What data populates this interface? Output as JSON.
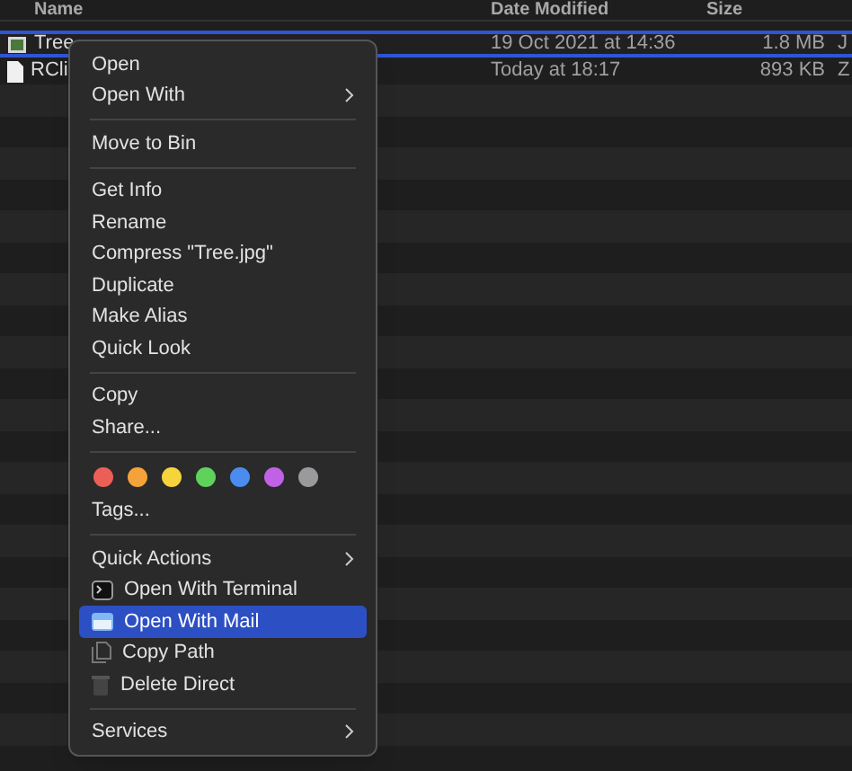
{
  "columns": [
    {
      "label": "Name"
    },
    {
      "label": "Date Modified"
    },
    {
      "label": "Size"
    }
  ],
  "files": [
    {
      "name": "Tree",
      "date": "19 Oct 2021 at 14:36",
      "size": "1.8 MB",
      "column_4": "J",
      "selected": true,
      "kind": "image"
    },
    {
      "name": "RCli",
      "date": "Today at 18:17",
      "size": "893 KB",
      "column_4": "Z",
      "selected": false,
      "kind": "document"
    }
  ],
  "context_menu": {
    "items": [
      {
        "kind": "item",
        "label": "Open",
        "submenu": false
      },
      {
        "kind": "item",
        "label": "Open With",
        "submenu": true
      },
      {
        "kind": "separator"
      },
      {
        "kind": "item",
        "label": "Move to Bin",
        "submenu": false
      },
      {
        "kind": "separator"
      },
      {
        "kind": "item",
        "label": "Get Info",
        "submenu": false
      },
      {
        "kind": "item",
        "label": "Rename",
        "submenu": false
      },
      {
        "kind": "item",
        "label": "Compress \"Tree.jpg\"",
        "submenu": false
      },
      {
        "kind": "item",
        "label": "Duplicate",
        "submenu": false
      },
      {
        "kind": "item",
        "label": "Make Alias",
        "submenu": false
      },
      {
        "kind": "item",
        "label": "Quick Look",
        "submenu": false
      },
      {
        "kind": "separator"
      },
      {
        "kind": "item",
        "label": "Copy",
        "submenu": false
      },
      {
        "kind": "item",
        "label": "Share...",
        "submenu": false
      },
      {
        "kind": "separator"
      },
      {
        "kind": "tags",
        "dots": [
          {
            "color": "#ec5f57"
          },
          {
            "color": "#f5a23a"
          },
          {
            "color": "#f6d43c"
          },
          {
            "color": "#5fd25c"
          },
          {
            "color": "#4b8cf0"
          },
          {
            "color": "#c061e6"
          },
          {
            "color": "#9a9a9c"
          }
        ]
      },
      {
        "kind": "item",
        "label": "Tags...",
        "submenu": false
      },
      {
        "kind": "separator"
      },
      {
        "kind": "item",
        "label": "Quick Actions",
        "submenu": true
      },
      {
        "kind": "action",
        "label": "Open With Terminal",
        "selected": false
      },
      {
        "kind": "action",
        "label": "Open With Mail",
        "selected": true
      },
      {
        "kind": "action",
        "label": "Copy Path",
        "selected": false
      },
      {
        "kind": "action",
        "label": "Delete Direct",
        "selected": false
      },
      {
        "kind": "separator"
      },
      {
        "kind": "item",
        "label": "Services",
        "submenu": true
      }
    ]
  }
}
